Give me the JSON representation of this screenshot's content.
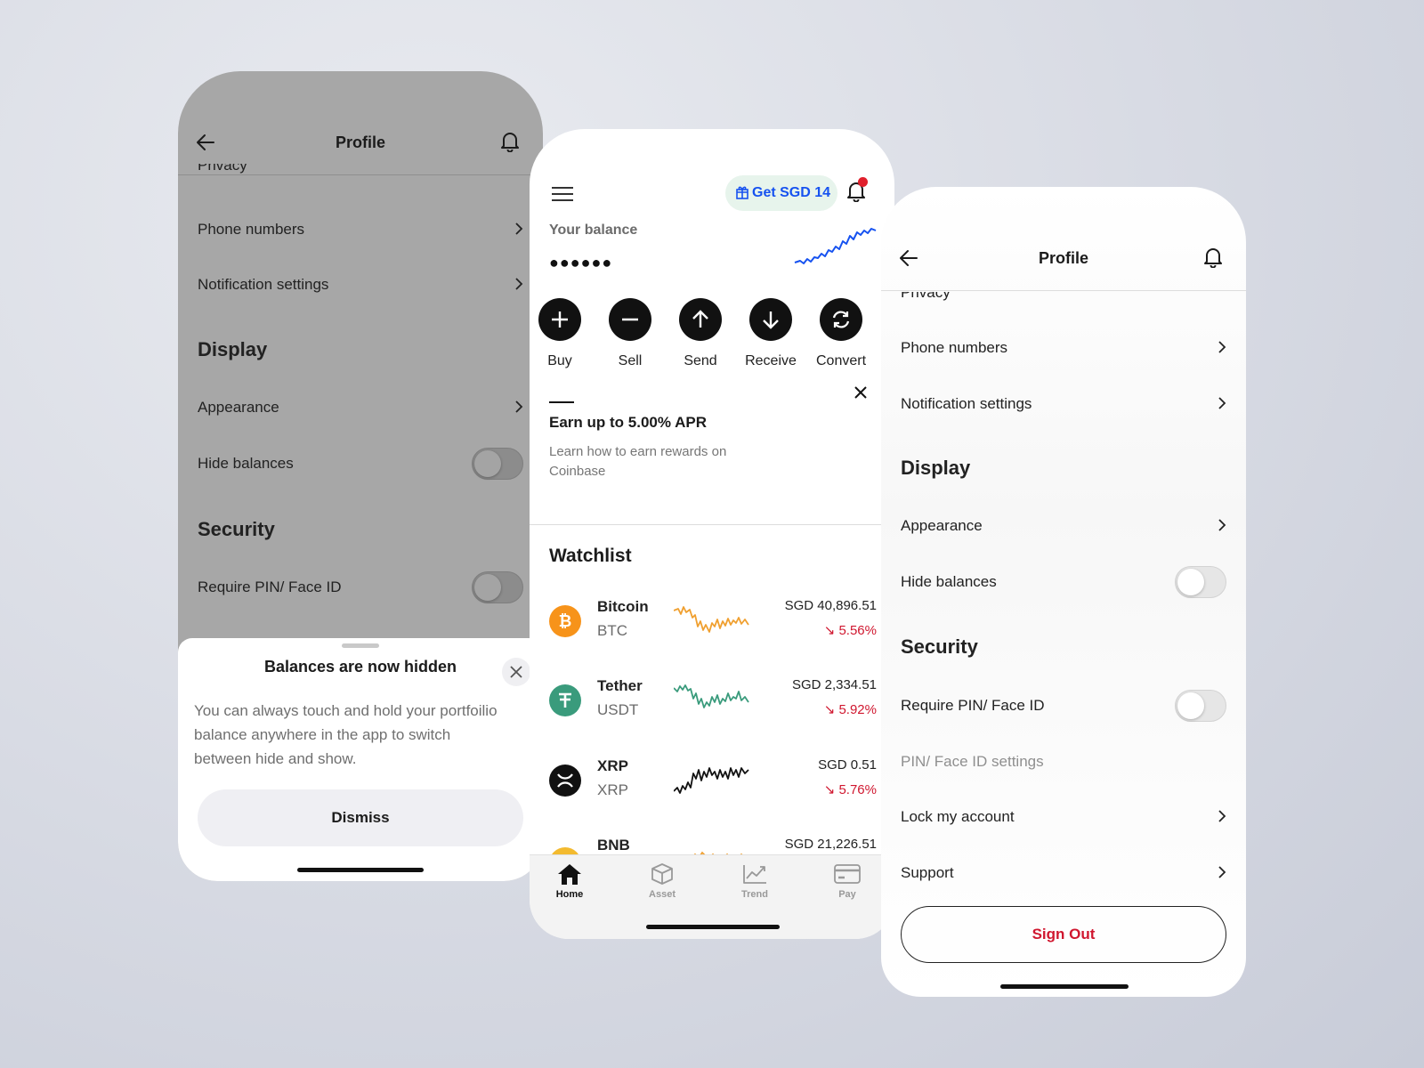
{
  "left_screen": {
    "title": "Profile",
    "partial_item": "Privacy",
    "items": [
      {
        "label": "Phone numbers"
      },
      {
        "label": "Notification settings"
      }
    ],
    "display_heading": "Display",
    "appearance_label": "Appearance",
    "hide_balances_label": "Hide balances",
    "hide_balances_on": false,
    "security_heading": "Security",
    "require_pin_label": "Require PIN/ Face ID",
    "require_pin_on": false,
    "sheet": {
      "title": "Balances are now hidden",
      "body": "You can always touch and hold your portfoilio balance anywhere in the app to switch between hide and show.",
      "button": "Dismiss"
    }
  },
  "middle_screen": {
    "reward_label": "Get SGD 14",
    "balance_label": "Your balance",
    "balance_masked": "●●●●●●",
    "actions": [
      "Buy",
      "Sell",
      "Send",
      "Receive",
      "Convert"
    ],
    "earn": {
      "title": "Earn up to 5.00% APR",
      "subtitle": "Learn how to earn rewards on Coinbase"
    },
    "watchlist_title": "Watchlist",
    "coins": [
      {
        "name": "Bitcoin",
        "symbol": "BTC",
        "price": "SGD 40,896.51",
        "change": "↘ 5.56%",
        "color": "#f7931a"
      },
      {
        "name": "Tether",
        "symbol": "USDT",
        "price": "SGD 2,334.51",
        "change": "↘ 5.92%",
        "color": "#3a9b7c"
      },
      {
        "name": "XRP",
        "symbol": "XRP",
        "price": "SGD 0.51",
        "change": "↘ 5.76%",
        "color": "#111111"
      },
      {
        "name": "BNB",
        "symbol": "BNB",
        "price": "SGD 21,226.51",
        "change": "",
        "color": "#f3ba2f"
      }
    ],
    "tabs": [
      "Home",
      "Asset",
      "Trend",
      "Pay"
    ],
    "active_tab": "Home"
  },
  "right_screen": {
    "title": "Profile",
    "partial_item": "Privacy",
    "items": [
      {
        "label": "Phone numbers"
      },
      {
        "label": "Notification settings"
      }
    ],
    "display_heading": "Display",
    "appearance_label": "Appearance",
    "hide_balances_label": "Hide balances",
    "hide_balances_on": false,
    "security_heading": "Security",
    "require_pin_label": "Require PIN/ Face ID",
    "require_pin_on": false,
    "pin_settings_label": "PIN/ Face ID settings",
    "lock_account_label": "Lock my account",
    "support_label": "Support",
    "sign_out_label": "Sign Out"
  },
  "colors": {
    "accent_blue": "#1652f0",
    "negative_red": "#d0172f",
    "notification_dot": "#e0202c"
  }
}
